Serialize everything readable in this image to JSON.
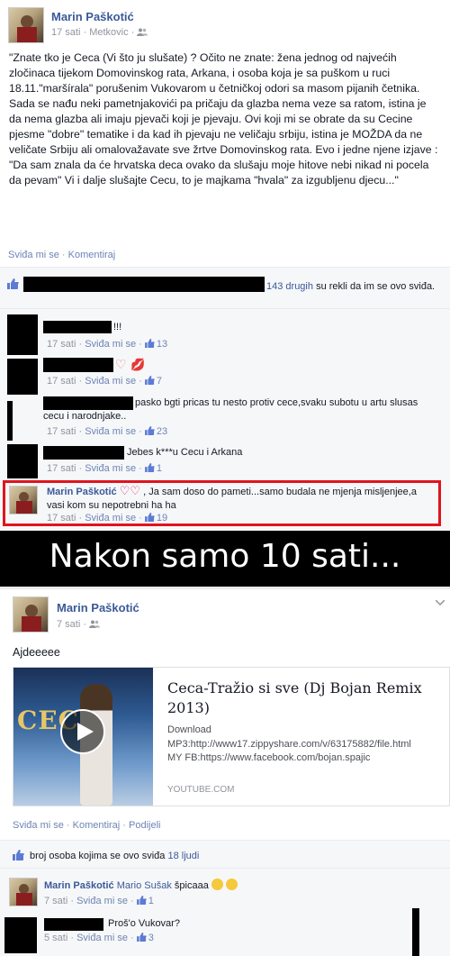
{
  "post1": {
    "author": "Marin Paškotić",
    "time": "17 sati",
    "dot": "·",
    "location": "Metkovic",
    "dot2": "·",
    "text": "\"Znate tko je Ceca (Vi što ju slušate) ? Očito ne znate: žena jednog od najvećih zločinaca tijekom Domovinskog rata, Arkana, i osoba koja je sa puškom u ruci 18.11.\"maršírala\" porušenim Vukovarom u četničkoj odori sa masom pijanih četnika. Sada se nađu neki pametnjakovići pa pričaju da glazba nema veze sa ratom, istina je da nema glazba ali imaju pjevači koji je pjevaju. Ovi koji mi se obrate da su Cecine pjesme \"dobre\" tematike i da kad ih pjevaju ne veličaju srbiju, istina je MOŽDA da ne veličate Srbiju ali omalovažavate sve žrtve Domovinskog rata. Evo i jedne njene izjave : \"Da sam znala da će hrvatska deca ovako da slušaju moje hitove nebi nikad ni pocela da pevam\" Vi i dalje slušajte Cecu, to je majkama \"hvala\" za izgubljenu djecu...\"",
    "actions": {
      "like": "Sviđa mi se",
      "dot": "·",
      "comment": "Komentiraj"
    },
    "likes": {
      "others": "143 drugih",
      "rest": "su rekli da im se ovo sviđa."
    },
    "comments": [
      {
        "text": "!!!",
        "time": "17 sati",
        "like": "Sviđa mi se",
        "count": "13"
      },
      {
        "text": "",
        "time": "17 sati",
        "like": "Sviđa mi se",
        "count": "7"
      },
      {
        "text": "pasko bgti pricas tu nesto protiv cece,svaku subotu u artu slusas cecu i narodnjake..",
        "time": "17 sati",
        "like": "Sviđa mi se",
        "count": "23"
      },
      {
        "text": "Jebes k***u Cecu i Arkana",
        "time": "17 sati",
        "like": "Sviđa mi se",
        "count": "1"
      },
      {
        "author": "Marin Paškotić",
        "text": ", Ja sam doso do pameti...samo budala ne mjenja misljenjee,a vasi kom su nepotrebni ha ha",
        "time": "17 sati",
        "like": "Sviđa mi se",
        "count": "19"
      }
    ]
  },
  "banner": "Nakon samo 10 sati...",
  "post2": {
    "author": "Marin Paškotić",
    "time": "7 sati",
    "dot": "·",
    "text": "Ajdeeeee",
    "video": {
      "overlay_text": "CECA",
      "title": "Ceca-Tražio si sve (Dj Bojan Remix 2013)",
      "line1": "Download",
      "line2": "MP3:http://www17.zippyshare.com/v/63175882/file.html",
      "line3": "MY FB:https://www.facebook.com/bojan.spajic",
      "source": "YOUTUBE.COM"
    },
    "actions": {
      "like": "Sviđa mi se",
      "dot": "·",
      "comment": "Komentiraj",
      "dot2": "·",
      "share": "Podijeli"
    },
    "likes": {
      "text": "broj osoba kojima se ovo sviđa",
      "count": "18 ljudi"
    },
    "comments": [
      {
        "author": "Marin Paškotić",
        "mention": "Mario Sušak",
        "text": "špicaaa",
        "time": "7 sati",
        "like": "Sviđa mi se",
        "count": "1"
      },
      {
        "text": "Proš'o Vukovar?",
        "time": "5 sati",
        "like": "Sviđa mi se",
        "count": "3"
      }
    ]
  },
  "colors": {
    "link": "#3b5998",
    "like_blue": "#5b7bd5",
    "highlight_red": "#e0141e",
    "banner_bg": "#000000"
  }
}
